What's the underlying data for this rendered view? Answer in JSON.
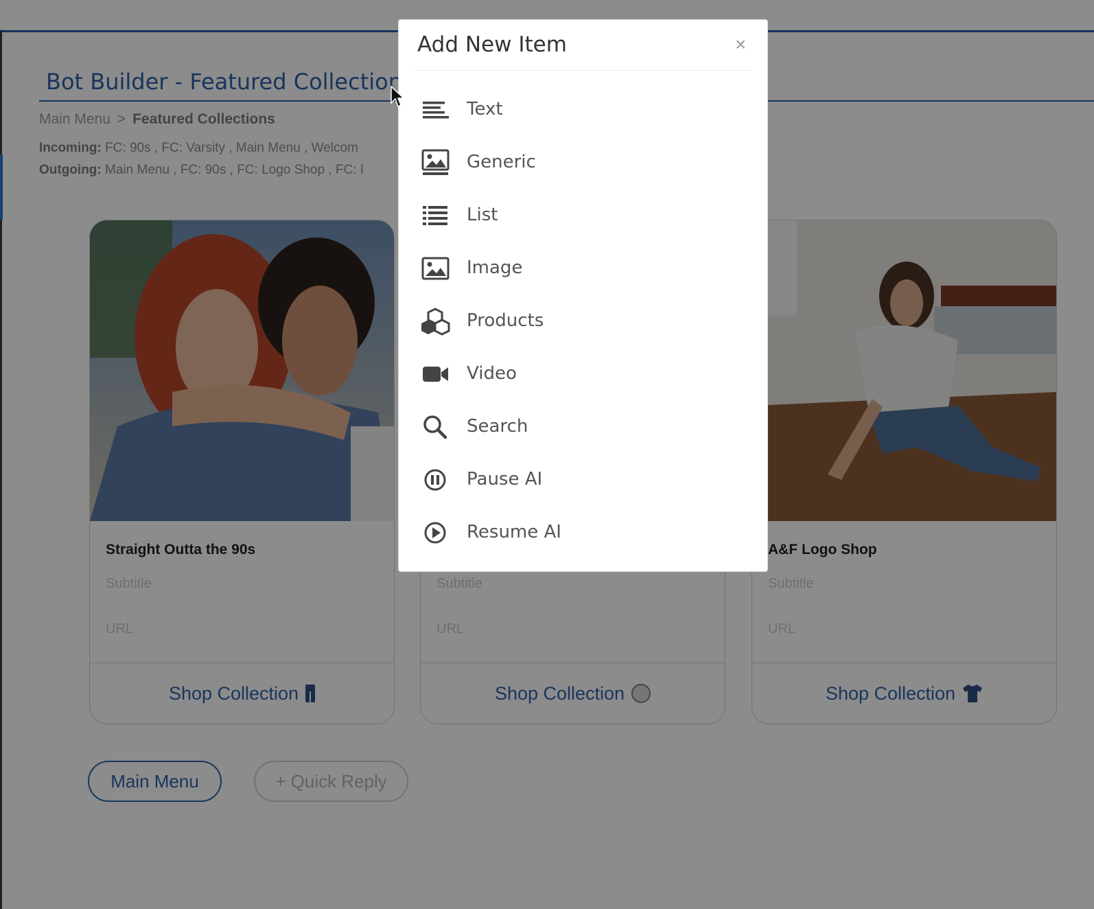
{
  "page": {
    "title": "Bot Builder - Featured Collections",
    "breadcrumb": {
      "home": "Main Menu",
      "separator": ">",
      "current": "Featured Collections"
    },
    "incoming": {
      "label": "Incoming:",
      "value": " FC: 90s , FC: Varsity , Main Menu , Welcom"
    },
    "outgoing": {
      "label": "Outgoing:",
      "value": " Main Menu , FC: 90s , FC: Logo Shop , FC: I"
    }
  },
  "cards": [
    {
      "title": "Straight Outta the 90s",
      "subtitle_placeholder": "Subtitle",
      "url_placeholder": "URL",
      "button_label": "Shop Collection",
      "button_icon": "jeans-icon"
    },
    {
      "title": "",
      "subtitle_placeholder": "Subtitle",
      "url_placeholder": "URL",
      "button_label": "Shop Collection",
      "button_icon": "baseball-icon"
    },
    {
      "title": "A&F Logo Shop",
      "subtitle_placeholder": "Subtitle",
      "url_placeholder": "URL",
      "button_label": "Shop Collection",
      "button_icon": "tshirt-icon"
    }
  ],
  "quick_replies": {
    "main_menu": "Main Menu",
    "add_quick_reply": "+ Quick Reply"
  },
  "modal": {
    "title": "Add New Item",
    "close": "×",
    "items": [
      {
        "label": "Text",
        "icon": "text-icon"
      },
      {
        "label": "Generic",
        "icon": "generic-card-icon"
      },
      {
        "label": "List",
        "icon": "list-icon"
      },
      {
        "label": "Image",
        "icon": "image-icon"
      },
      {
        "label": "Products",
        "icon": "cubes-icon"
      },
      {
        "label": "Video",
        "icon": "video-camera-icon"
      },
      {
        "label": "Search",
        "icon": "search-icon"
      },
      {
        "label": "Pause AI",
        "icon": "pause-circle-icon"
      },
      {
        "label": "Resume AI",
        "icon": "play-circle-icon"
      }
    ]
  },
  "colors": {
    "brand_blue": "#2e63a9",
    "overlay": "rgba(0,0,0,0.45)",
    "icon_dark": "#444444"
  }
}
